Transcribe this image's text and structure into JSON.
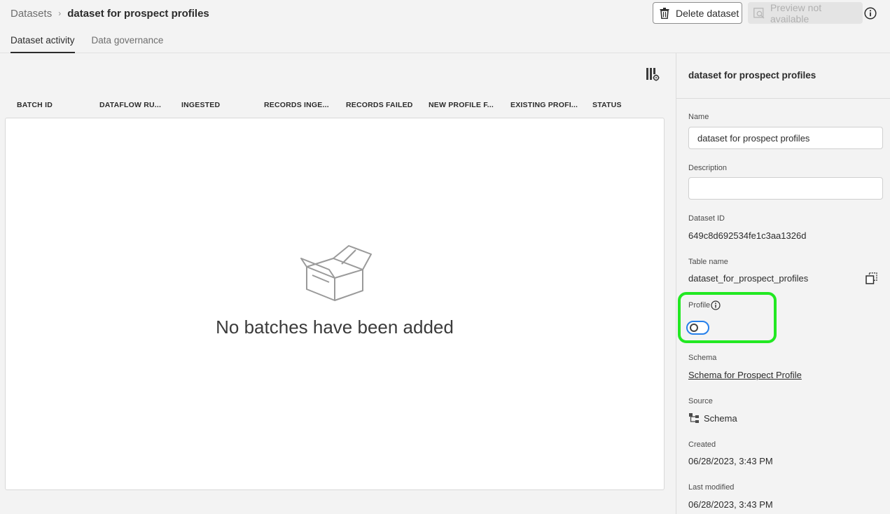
{
  "breadcrumb": {
    "root": "Datasets",
    "separator": "›",
    "current": "dataset for prospect profiles"
  },
  "actions": {
    "delete_label": "Delete dataset",
    "preview_label": "Preview not available"
  },
  "tabs": [
    {
      "label": "Dataset activity",
      "active": true
    },
    {
      "label": "Data governance",
      "active": false
    }
  ],
  "table": {
    "columns": [
      "BATCH ID",
      "DATAFLOW RU...",
      "INGESTED",
      "RECORDS INGE...",
      "RECORDS FAILED",
      "NEW PROFILE F...",
      "EXISTING PROFI...",
      "STATUS"
    ],
    "rows": [],
    "empty_message": "No batches have been added"
  },
  "panel": {
    "title": "dataset for prospect profiles",
    "name_label": "Name",
    "name_value": "dataset for prospect profiles",
    "description_label": "Description",
    "description_value": "",
    "dataset_id_label": "Dataset ID",
    "dataset_id": "649c8d692534fe1c3aa1326d",
    "table_name_label": "Table name",
    "table_name": "dataset_for_prospect_profiles",
    "profile_label": "Profile",
    "profile_enabled": false,
    "schema_label": "Schema",
    "schema_link": "Schema for Prospect Profile",
    "source_label": "Source",
    "source_value": "Schema",
    "created_label": "Created",
    "created_value": "06/28/2023, 3:43 PM",
    "modified_label": "Last modified",
    "modified_value": "06/28/2023, 3:43 PM"
  },
  "colors": {
    "highlight": "#22e822",
    "toggle_border": "#2680eb"
  },
  "icons": [
    "trash-icon",
    "preview-icon",
    "info-icon",
    "column-settings-icon",
    "empty-box-icon",
    "copy-icon",
    "source-icon"
  ]
}
